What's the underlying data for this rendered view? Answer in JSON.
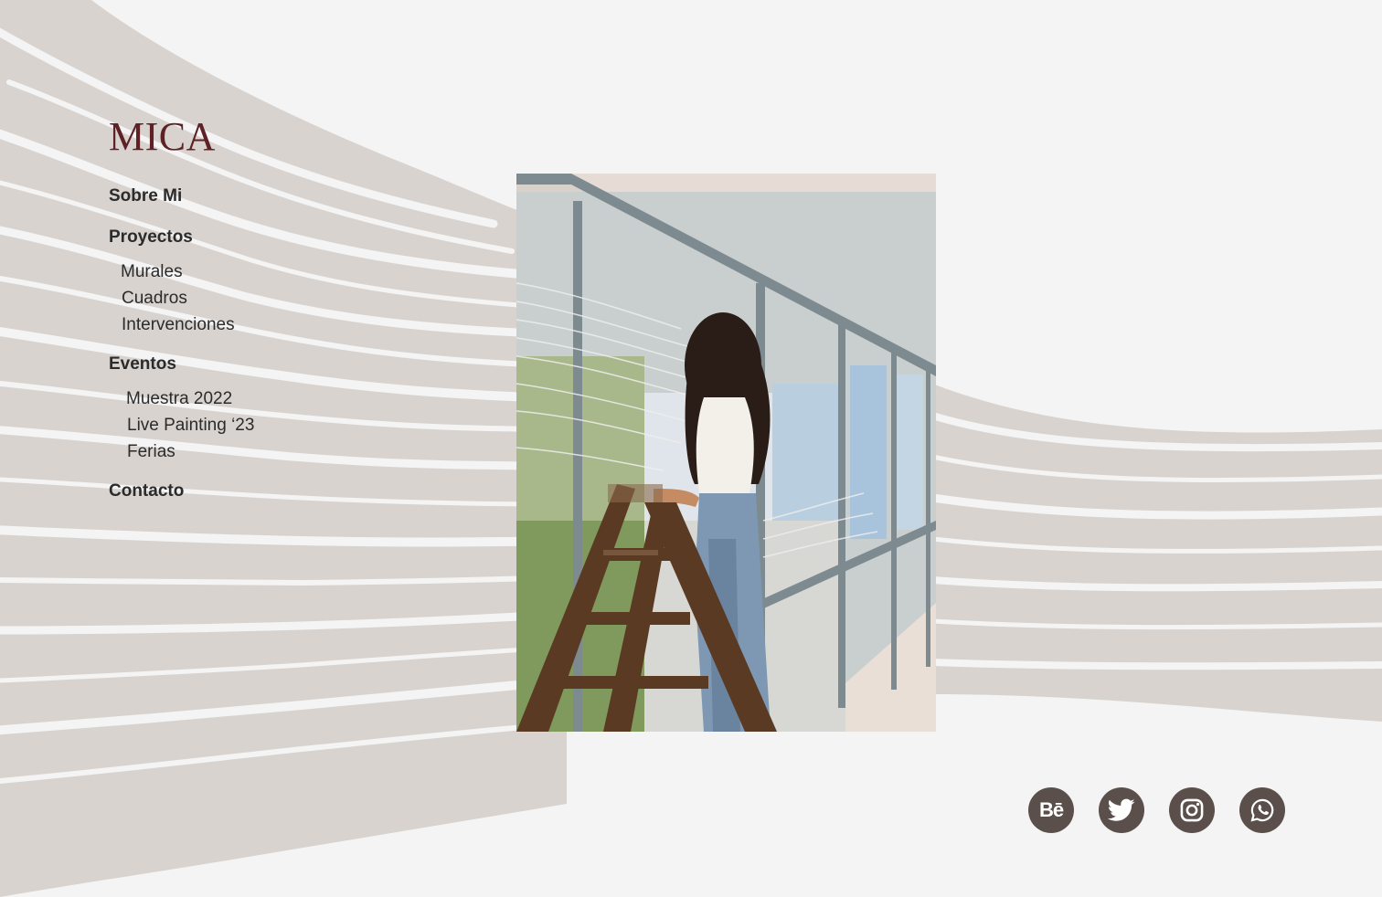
{
  "brand": {
    "name": "MICA",
    "color": "#5e2226"
  },
  "nav": {
    "sobre_mi": "Sobre Mi",
    "proyectos": "Proyectos",
    "proyectos_items": [
      "Murales",
      "Cuadros",
      "Intervenciones"
    ],
    "eventos": "Eventos",
    "eventos_items": [
      "Muestra 2022",
      "Live Painting ‘23",
      "Ferias"
    ],
    "contacto": "Contacto"
  },
  "photo": {
    "subject": "artist-on-ladder-painting-window-mural"
  },
  "social": [
    {
      "name": "behance",
      "icon": "behance-icon",
      "glyph": "Bē"
    },
    {
      "name": "twitter",
      "icon": "twitter-icon"
    },
    {
      "name": "instagram",
      "icon": "instagram-icon"
    },
    {
      "name": "whatsapp",
      "icon": "whatsapp-icon"
    }
  ],
  "colors": {
    "background": "#f4f4f4",
    "wave": "#d8d3cf",
    "text": "#2b2b2b",
    "social_bg": "#5a4f4a"
  }
}
